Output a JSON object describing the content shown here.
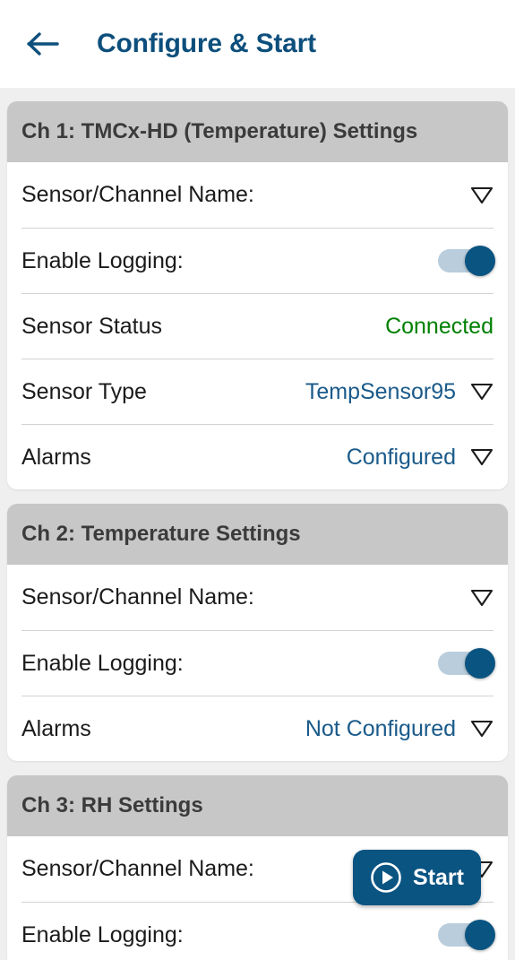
{
  "header": {
    "back_icon": "arrow-left-icon",
    "title": "Configure & Start"
  },
  "colors": {
    "accent_blue": "#0a5482",
    "title_blue": "#0d4f7c",
    "link_blue": "#1a5a8a",
    "status_green": "#008000",
    "card_header_gray": "#c7c7c7",
    "page_background": "#efeff0"
  },
  "cards": [
    {
      "title": "Ch 1: TMCx-HD (Temperature) Settings",
      "rows": [
        {
          "label": "Sensor/Channel Name:",
          "value": "",
          "control": "caret"
        },
        {
          "label": "Enable Logging:",
          "value": "",
          "control": "toggle",
          "toggle_on": true
        },
        {
          "label": "Sensor Status",
          "value": "Connected",
          "control": "none",
          "value_style": "status-ok"
        },
        {
          "label": "Sensor Type",
          "value": "TempSensor95",
          "control": "caret",
          "value_style": "link"
        },
        {
          "label": "Alarms",
          "value": "Configured",
          "control": "caret",
          "value_style": "link"
        }
      ]
    },
    {
      "title": "Ch 2: Temperature Settings",
      "rows": [
        {
          "label": "Sensor/Channel Name:",
          "value": "",
          "control": "caret"
        },
        {
          "label": "Enable Logging:",
          "value": "",
          "control": "toggle",
          "toggle_on": true
        },
        {
          "label": "Alarms",
          "value": "Not Configured",
          "control": "caret",
          "value_style": "link"
        }
      ]
    },
    {
      "title": "Ch 3: RH Settings",
      "rows": [
        {
          "label": "Sensor/Channel Name:",
          "value": "",
          "control": "caret"
        },
        {
          "label": "Enable Logging:",
          "value": "",
          "control": "toggle",
          "toggle_on": true
        }
      ]
    }
  ],
  "start_button": {
    "label": "Start",
    "icon": "play-circle-icon"
  }
}
